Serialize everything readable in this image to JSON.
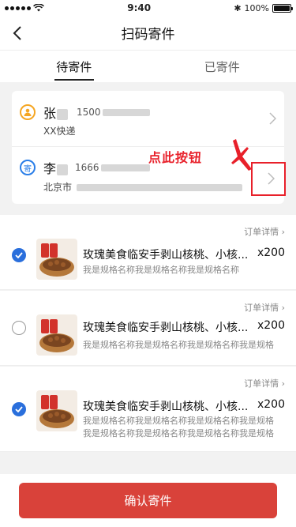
{
  "status_bar": {
    "time": "9:40",
    "battery": "100%",
    "battery_level": 1.0
  },
  "nav": {
    "title": "扫码寄件",
    "back_icon": "chevron-left-icon"
  },
  "tabs": [
    {
      "label": "待寄件",
      "active": true
    },
    {
      "label": "已寄件",
      "active": false
    }
  ],
  "sender": {
    "badge": "person-icon",
    "name": "张",
    "phone": "1500",
    "courier": "XX快递"
  },
  "receiver": {
    "badge": "寄",
    "name": "李",
    "phone": "1666",
    "address_prefix": "北京市"
  },
  "annotation": {
    "text": "点此按钮",
    "color": "#e8202a"
  },
  "orders": [
    {
      "detail_link": "订单详情 ›",
      "checked": true,
      "name": "玫瑰美食临安手剥山核桃、小核...",
      "qty": "x200",
      "spec": "我是规格名称我是规格名称我是规格名称"
    },
    {
      "detail_link": "订单详情 ›",
      "checked": false,
      "name": "玫瑰美食临安手剥山核桃、小核...",
      "qty": "x200",
      "spec": "我是规格名称我是规格名称我是规格名称我是规格"
    },
    {
      "detail_link": "订单详情 ›",
      "checked": true,
      "name": "玫瑰美食临安手剥山核桃、小核...",
      "qty": "x200",
      "spec": "我是规格名称我是规格名称我是规格名称我是规格我是规格名称我是规格名称我是规格名称我是规格"
    }
  ],
  "footer": {
    "confirm_label": "确认寄件",
    "accent": "#d9423a"
  },
  "colors": {
    "check_on": "#2a6fdc",
    "sender_badge": "#f5a623",
    "receiver_badge": "#2a7ee8"
  }
}
